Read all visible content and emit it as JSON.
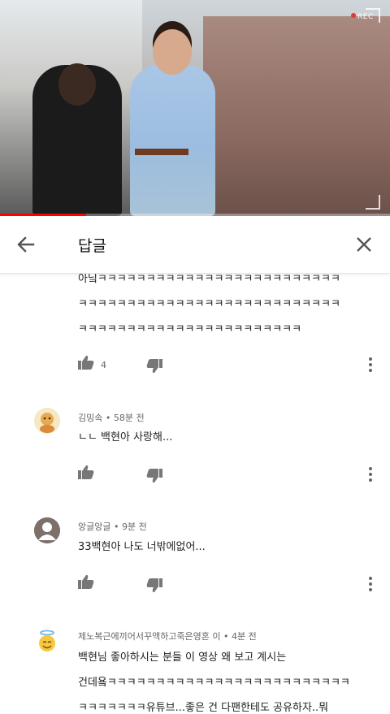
{
  "video": {
    "rec_label": "REC",
    "progress_fraction": 0.22
  },
  "header": {
    "title": "답글",
    "back_icon": "arrow-left-icon",
    "close_icon": "close-icon"
  },
  "comments": [
    {
      "lines": [
        "아닠ㅋㅋㅋㅋㅋㅋㅋㅋㅋㅋㅋㅋㅋㅋㅋㅋㅋㅋㅋㅋㅋㅋㅋㅋㅋ",
        "ㅋㅋㅋㅋㅋㅋㅋㅋㅋㅋㅋㅋㅋㅋㅋㅋㅋㅋㅋㅋㅋㅋㅋㅋㅋㅋㅋ",
        "ㅋㅋㅋㅋㅋㅋㅋㅋㅋㅋㅋㅋㅋㅋㅋㅋㅋㅋㅋㅋㅋㅋㅋ"
      ],
      "likes": "4"
    },
    {
      "author": "김밍속",
      "time": "58분 전",
      "lines": [
        "ㄴㄴ 백현아 사랑해..."
      ],
      "likes": ""
    },
    {
      "author": "앙글앙글",
      "time": "9분 전",
      "lines": [
        "33백현아 나도 너밖에없어..."
      ],
      "likes": ""
    },
    {
      "author": "제노복근에끼어서꾸액하고죽은영혼 이",
      "time": "4분 전",
      "lines": [
        "백현님 좋아하시는 분들 이 영상 왜 보고 계시는",
        "건데욬ㅋㅋㅋㅋㅋㅋㅋㅋㅋㅋㅋㅋㅋㅋㅋㅋㅋㅋㅋㅋㅋㅋㅋㅋㅋ",
        "ㅋㅋㅋㅋㅋㅋㅋ유튜브...좋은 건 다팬한테도 공유하자..뭐"
      ]
    }
  ],
  "icons": {
    "like": "thumbs-up-icon",
    "dislike": "thumbs-down-icon",
    "more": "more-vertical-icon"
  },
  "colors": {
    "accent_red": "#ff0000",
    "meta_gray": "#666666"
  }
}
